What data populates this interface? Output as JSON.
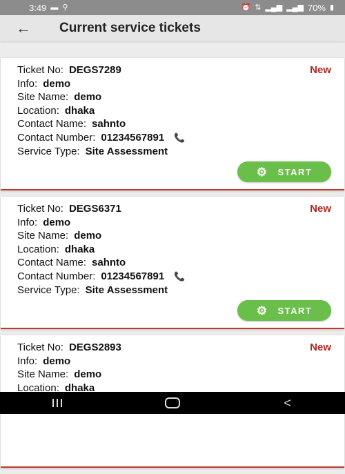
{
  "status_bar": {
    "time": "3:49",
    "left_icons": [
      "message-icon",
      "bicycle-icon"
    ],
    "right_icons": [
      "alarm-icon",
      "data-icon",
      "signal-icon",
      "signal-icon",
      "battery-icon"
    ],
    "battery": "70%"
  },
  "app_bar": {
    "title": "Current service tickets"
  },
  "labels": {
    "ticket_no": "Ticket No:",
    "info": "Info:",
    "site_name": "Site Name:",
    "location": "Location:",
    "contact_name": "Contact Name:",
    "contact_number": "Contact Number:",
    "service_type": "Service Type:",
    "start_button": "START"
  },
  "tickets": [
    {
      "ticket_no": "DEGS7289",
      "status": "New",
      "info": "demo",
      "site_name": "demo",
      "location": "dhaka",
      "contact_name": "sahnto",
      "contact_number": "01234567891",
      "service_type": "Site Assessment"
    },
    {
      "ticket_no": "DEGS6371",
      "status": "New",
      "info": "demo",
      "site_name": "demo",
      "location": "dhaka",
      "contact_name": "sahnto",
      "contact_number": "01234567891",
      "service_type": "Site Assessment"
    },
    {
      "ticket_no": "DEGS2893",
      "status": "New",
      "info": "demo",
      "site_name": "demo",
      "location": "dhaka"
    }
  ],
  "colors": {
    "status_new": "#b3261e",
    "start_button": "#6abf4b",
    "card_border": "#c0392b"
  }
}
